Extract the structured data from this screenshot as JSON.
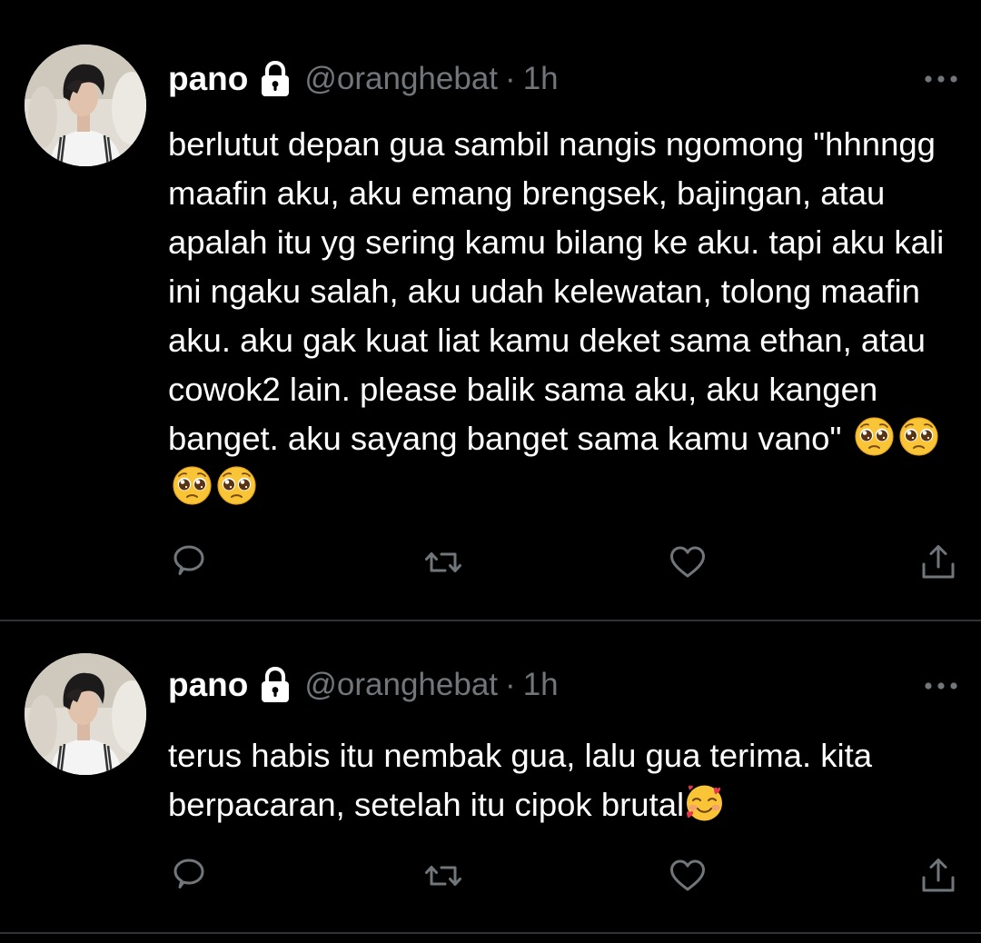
{
  "colors": {
    "background": "#000000",
    "text_primary": "#ffffff",
    "text_secondary": "#71767b",
    "divider": "#2f3336"
  },
  "tweets": [
    {
      "display_name": "pano",
      "protected_icon": "lock-icon",
      "handle": "@oranghebat",
      "separator": "·",
      "time": "1h",
      "text": "berlutut depan gua sambil nangis ngomong \"hhnngg maafin aku, aku emang brengsek, bajingan, atau apalah itu yg sering kamu bilang ke aku. tapi aku kali ini ngaku salah, aku udah kelewatan, tolong maafin aku. aku gak kuat liat kamu deket sama ethan, atau cowok2 lain. please balik sama aku, aku kangen banget. aku sayang banget sama kamu vano\"",
      "emojis": [
        "pleading-face-emoji",
        "pleading-face-emoji",
        "pleading-face-emoji",
        "pleading-face-emoji"
      ],
      "actions": [
        "reply-icon",
        "retweet-icon",
        "like-icon",
        "share-icon"
      ]
    },
    {
      "display_name": "pano",
      "protected_icon": "lock-icon",
      "handle": "@oranghebat",
      "separator": "·",
      "time": "1h",
      "text": "terus habis itu nembak gua, lalu gua terima. kita berpacaran, setelah itu cipok brutal",
      "emojis": [
        "smiling-face-with-hearts-emoji"
      ],
      "actions": [
        "reply-icon",
        "retweet-icon",
        "like-icon",
        "share-icon"
      ]
    }
  ]
}
